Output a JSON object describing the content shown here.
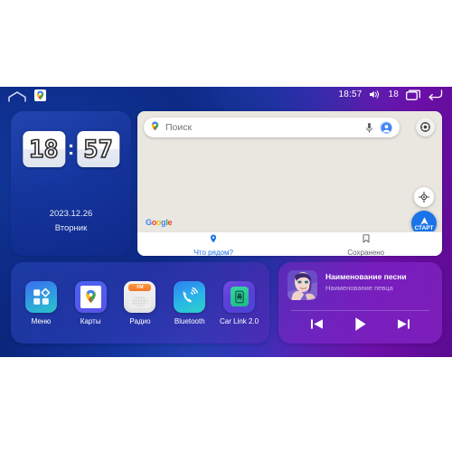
{
  "statusbar": {
    "home_icon": "home-icon",
    "maps_icon": "maps-app-icon",
    "time": "18:57",
    "volume_icon": "volume-icon",
    "volume_level": "18",
    "recents_icon": "recents-icon",
    "back_icon": "back-icon"
  },
  "clock": {
    "hours": "18",
    "separator": ":",
    "minutes": "57",
    "date": "2023.12.26",
    "weekday": "Вторник"
  },
  "map": {
    "search_placeholder": "Поиск",
    "pin_icon": "map-pin-icon",
    "mic_icon": "microphone-icon",
    "avatar_icon": "account-avatar-icon",
    "layers_icon": "layers-settings-icon",
    "locate_icon": "my-location-icon",
    "start_button_label": "СТАРТ",
    "brand": [
      "G",
      "o",
      "o",
      "g",
      "l",
      "e"
    ],
    "brand_colors": [
      "#4285f4",
      "#ea4335",
      "#fbbc05",
      "#4285f4",
      "#34a853",
      "#ea4335"
    ],
    "tabs": [
      {
        "label": "Что рядом?",
        "icon": "nearby-pin-icon",
        "active": true
      },
      {
        "label": "Сохранено",
        "icon": "bookmark-icon",
        "active": false
      }
    ]
  },
  "apps": [
    {
      "label": "Меню",
      "icon": "menu-grid-icon"
    },
    {
      "label": "Карты",
      "icon": "maps-app-icon"
    },
    {
      "label": "Радио",
      "icon": "radio-icon",
      "band": "FM"
    },
    {
      "label": "Bluetooth",
      "icon": "bluetooth-phone-icon"
    },
    {
      "label": "Car Link 2.0",
      "icon": "car-link-icon"
    }
  ],
  "music": {
    "title": "Наименование песни",
    "artist": "Наименование певца",
    "album_art": "album-art-portrait",
    "prev_icon": "previous-track-icon",
    "play_icon": "play-icon",
    "next_icon": "next-track-icon"
  },
  "colors": {
    "accent_blue": "#1a73e8",
    "bg_left": "#0d2a86",
    "bg_right": "#5c0b92",
    "music_purple": "#7a24c4"
  }
}
